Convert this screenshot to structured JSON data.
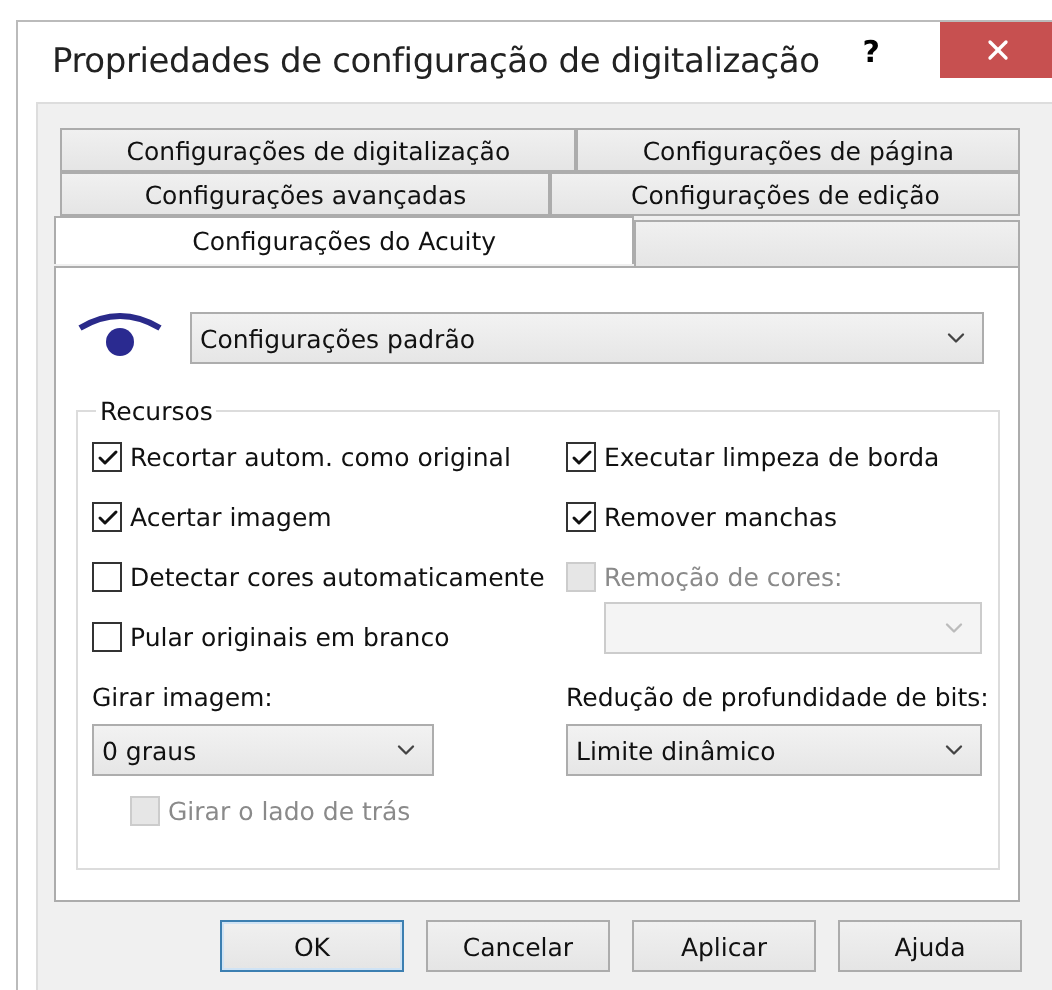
{
  "window": {
    "title": "Propriedades de configuração de digitalização",
    "help": "?"
  },
  "tab_rows": [
    [
      {
        "label": "Configurações de digitalização",
        "selected": false
      },
      {
        "label": "Configurações de página",
        "selected": false
      }
    ],
    [
      {
        "label": "Configurações avançadas",
        "selected": false
      },
      {
        "label": "Configurações de edição",
        "selected": false
      }
    ],
    [
      {
        "label": "Configurações do Acuity",
        "selected": true
      }
    ]
  ],
  "preset": {
    "value": "Configurações padrão"
  },
  "features": {
    "title": "Recursos",
    "left": [
      {
        "label": "Recortar autom. como original",
        "checked": true,
        "disabled": false
      },
      {
        "label": "Acertar imagem",
        "checked": true,
        "disabled": false
      },
      {
        "label": "Detectar cores automaticamente",
        "checked": false,
        "disabled": false
      },
      {
        "label": "Pular originais em branco",
        "checked": false,
        "disabled": false
      }
    ],
    "right": [
      {
        "label": "Executar limpeza de borda",
        "checked": true,
        "disabled": false
      },
      {
        "label": "Remover manchas",
        "checked": true,
        "disabled": false
      },
      {
        "label": "Remoção de cores:",
        "checked": false,
        "disabled": true
      }
    ],
    "color_select": {
      "disabled": true
    },
    "rotate": {
      "label": "Girar imagem:",
      "value": "0 graus"
    },
    "bit_depth": {
      "label": "Redução de profundidade de bits:",
      "value": "Limite dinâmico"
    },
    "rotate_back": {
      "label": "Girar o lado de trás",
      "checked": false,
      "disabled": true
    }
  },
  "buttons": [
    {
      "label": "OK",
      "focused": true
    },
    {
      "label": "Cancelar",
      "focused": false
    },
    {
      "label": "Aplicar",
      "focused": false
    },
    {
      "label": "Ajuda",
      "focused": false
    }
  ]
}
